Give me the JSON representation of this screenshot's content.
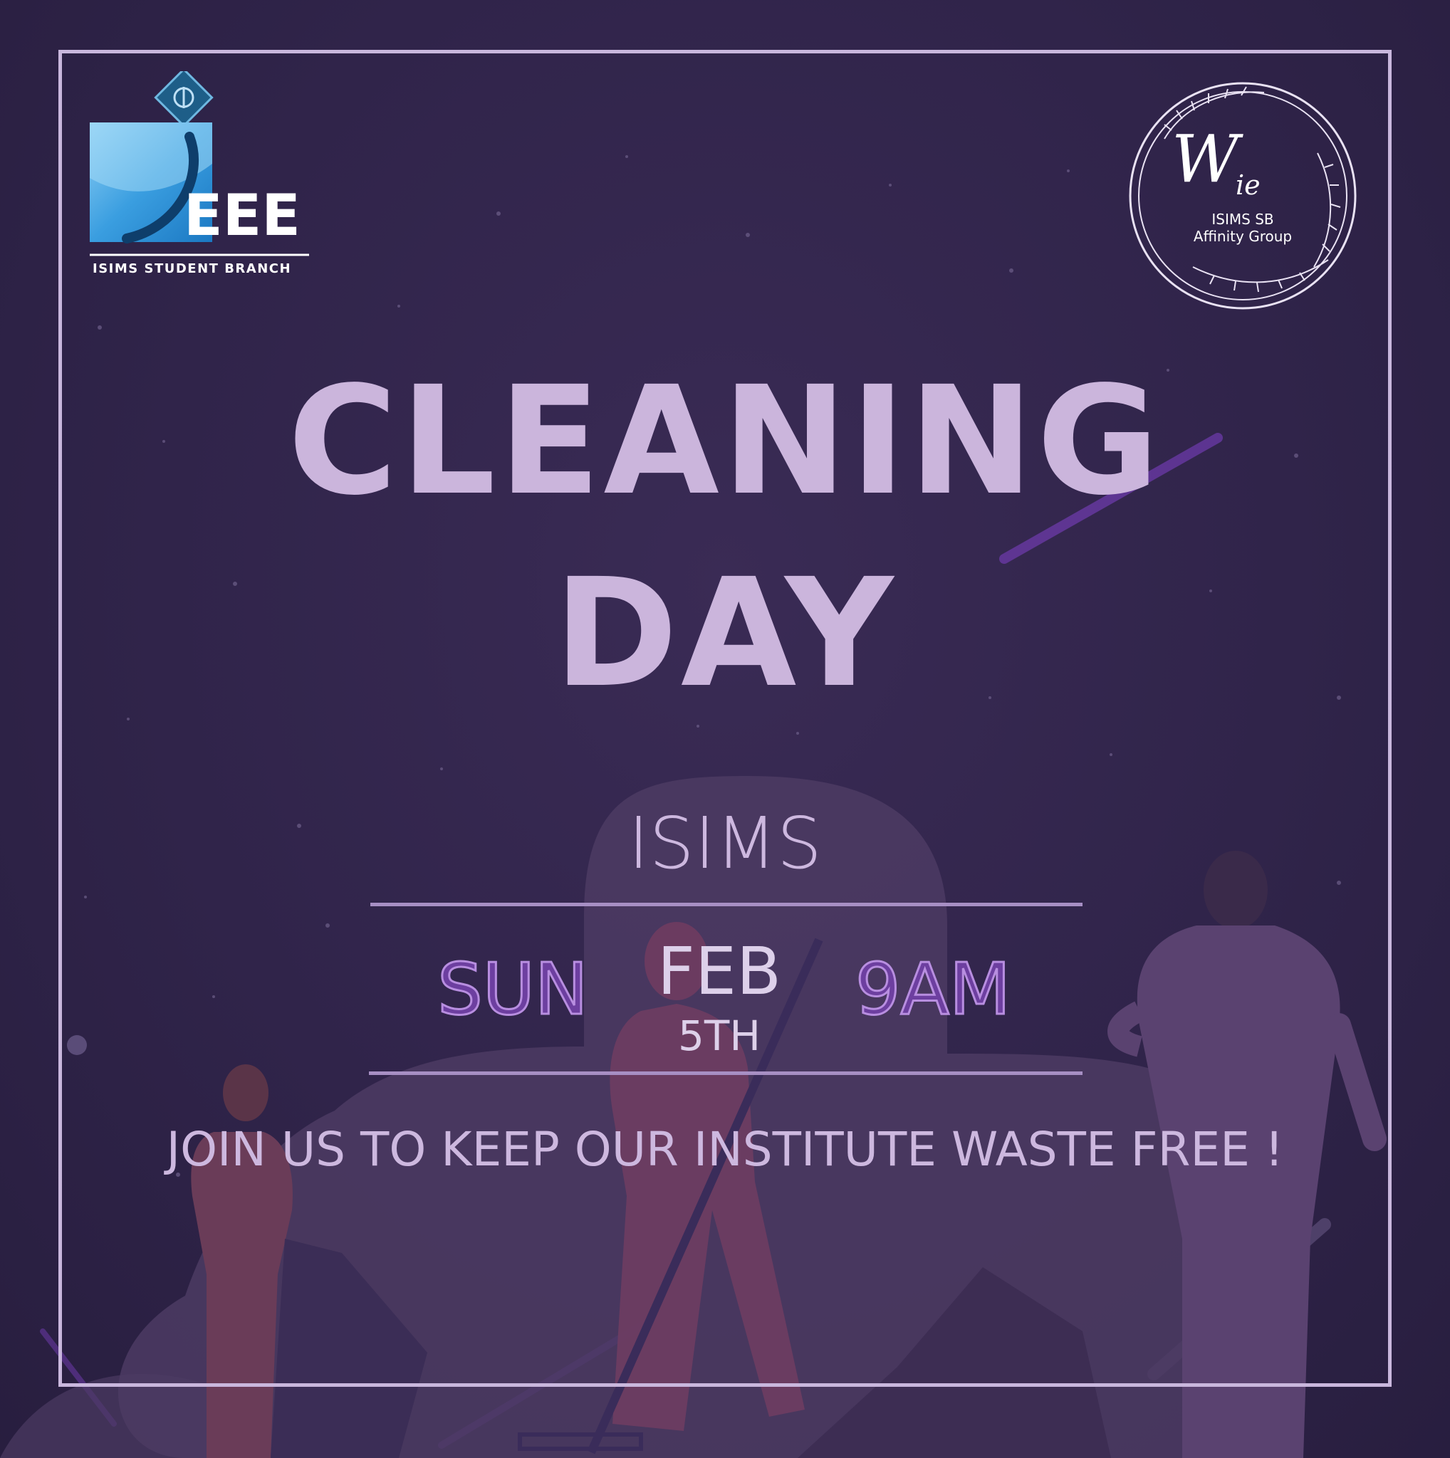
{
  "header": {
    "ieee_logo_text": "IEEE",
    "ieee_branch": "ISIMS STUDENT BRANCH",
    "wie_logo_text": "Wie",
    "wie_line1": "ISIMS SB",
    "wie_line2": "Affinity Group"
  },
  "title": {
    "line1": "CLEANING",
    "line2": "DAY"
  },
  "event": {
    "venue": "ISIMS",
    "day": "SUN",
    "month": "FEB",
    "date": "5TH",
    "time": "9AM"
  },
  "tagline": "JOIN US TO KEEP OUR INSTITUTE WASTE FREE !",
  "colors": {
    "background": "#2f2446",
    "accent": "#cbb5dc",
    "highlight": "#6d3fa0"
  }
}
